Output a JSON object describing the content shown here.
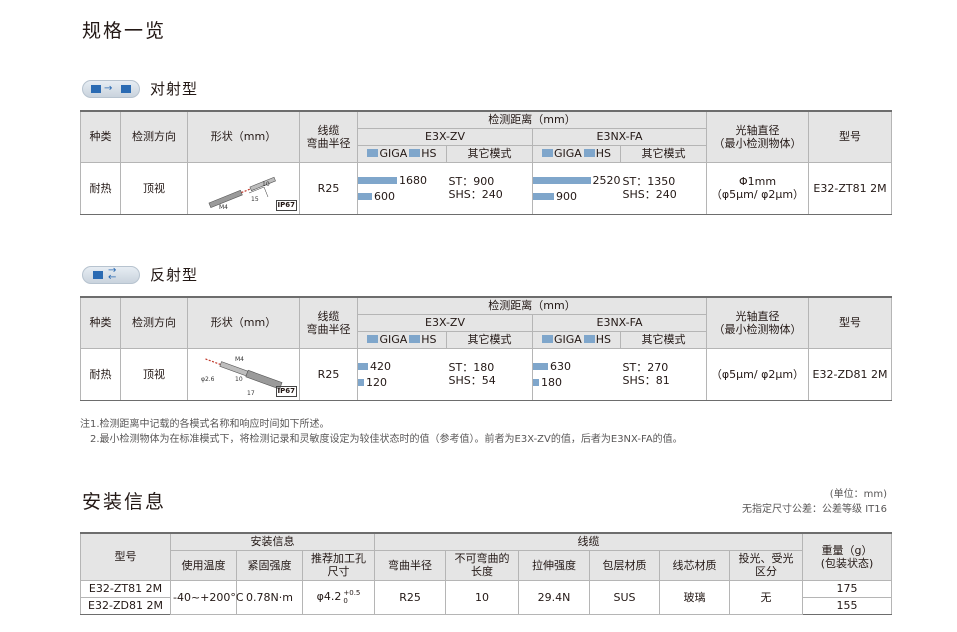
{
  "page_title": "规格一览",
  "section1": {
    "title": "对射型",
    "headers": {
      "type": "种类",
      "direction": "检测方向",
      "shape": "形状（mm）",
      "cable_line1": "线缆",
      "cable_line2": "弯曲半径",
      "distance": "检测距离（mm）",
      "amp1": "E3X-ZV",
      "amp2": "E3NX-FA",
      "giga": "GIGA",
      "hs": "HS",
      "other_modes": "其它模式",
      "axis_line1": "光轴直径",
      "axis_line2": "（最小检测物体）",
      "model": "型号"
    },
    "row": {
      "type": "耐热",
      "direction": "顶视",
      "shape_labels": {
        "m": "M4",
        "d1": "15",
        "d2": "10",
        "ip": "IP67"
      },
      "bend": "R25",
      "zv_giga": 1680,
      "zv_giga_label": "1680",
      "zv_hs": 600,
      "zv_hs_label": "600",
      "zv_st": "ST：900",
      "zv_shs": "SHS：240",
      "fa_giga": 2520,
      "fa_giga_label": "2520",
      "fa_hs": 900,
      "fa_hs_label": "900",
      "fa_st": "ST：1350",
      "fa_shs": "SHS：240",
      "axis1": "Φ1mm",
      "axis2": "（φ5μm/ φ2μm）",
      "model": "E32-ZT81 2M"
    }
  },
  "section2": {
    "title": "反射型",
    "row": {
      "type": "耐热",
      "direction": "顶视",
      "shape_labels": {
        "m": "M4",
        "dia": "φ2.6",
        "d1": "10",
        "d2": "17",
        "ip": "IP67"
      },
      "bend": "R25",
      "zv_giga": 420,
      "zv_giga_label": "420",
      "zv_hs": 120,
      "zv_hs_label": "120",
      "zv_st": "ST：180",
      "zv_shs": "SHS：54",
      "fa_giga": 630,
      "fa_giga_label": "630",
      "fa_hs": 180,
      "fa_hs_label": "180",
      "fa_st": "ST：270",
      "fa_shs": "SHS：81",
      "axis": "（φ5μm/ φ2μm）",
      "model": "E32-ZD81 2M"
    }
  },
  "notes": {
    "n1": "注1.检测距离中记载的各模式名称和响应时间如下所述。",
    "n2": "2.最小检测物体为在标准模式下，将检测记录和灵敏度设定为较佳状态时的值（参考值）。前者为E3X-ZV的值，后者为E3NX-FA的值。"
  },
  "install": {
    "title": "安装信息",
    "unit": "(单位：mm)",
    "tolerance": "无指定尺寸公差：公差等级 IT16",
    "headers": {
      "model": "型号",
      "install_info": "安装信息",
      "temp": "使用温度",
      "torque": "紧固强度",
      "hole1": "推荐加工孔",
      "hole2": "尺寸",
      "cable": "线缆",
      "bend": "弯曲半径",
      "nonbend1": "不可弯曲的",
      "nonbend2": "长度",
      "tensile": "拉伸强度",
      "sheath": "包层材质",
      "core": "线芯材质",
      "emit1": "投光、受光",
      "emit2": "区分",
      "weight1": "重量（g）",
      "weight2": "(包装状态)"
    },
    "rows": [
      {
        "model": "E32-ZT81 2M",
        "weight": "175"
      },
      {
        "model": "E32-ZD81 2M",
        "weight": "155"
      }
    ],
    "shared": {
      "temp": "-40~+200°C",
      "torque": "0.78N·m",
      "hole": "φ4.2",
      "hole_sup": "+0.5",
      "hole_sub": "0",
      "bend": "R25",
      "nonbend": "10",
      "tensile": "29.4N",
      "sheath": "SUS",
      "core": "玻璃",
      "emit": "无"
    }
  },
  "colors": {
    "bar": "#7fa6cb",
    "header_bg": "#e5e5e5",
    "icon_blue": "#2b6bb3"
  }
}
